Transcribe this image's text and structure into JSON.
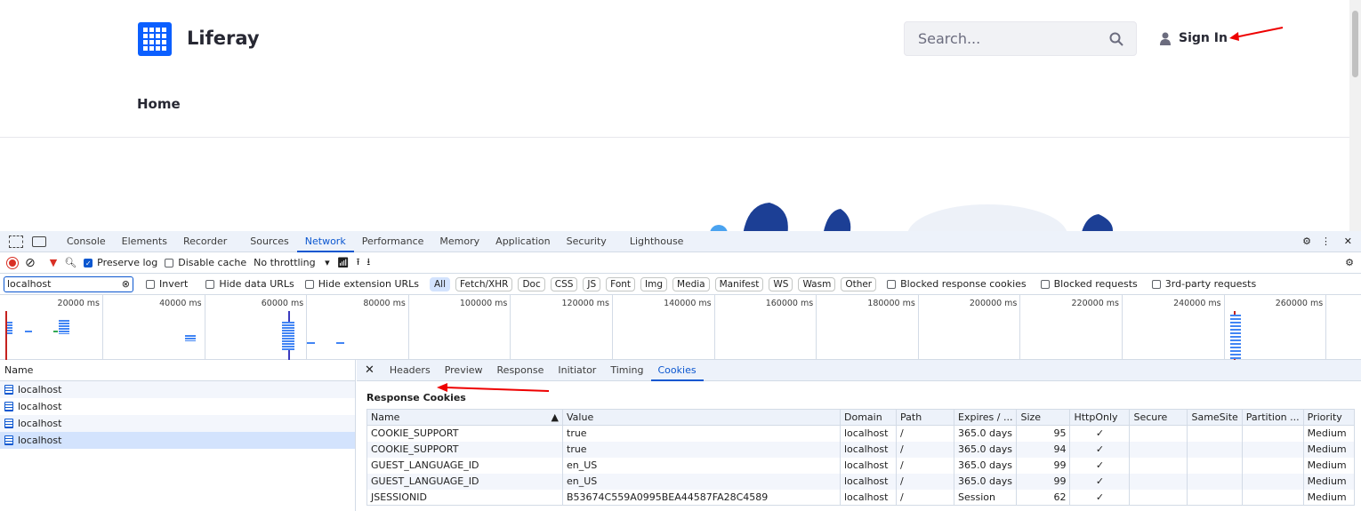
{
  "site": {
    "brand": "Liferay",
    "search_placeholder": "Search...",
    "sign_in": "Sign In",
    "nav_home": "Home"
  },
  "devtools": {
    "tabs": [
      "Console",
      "Elements",
      "Recorder",
      "Sources",
      "Network",
      "Performance",
      "Memory",
      "Application",
      "Security",
      "Lighthouse"
    ],
    "active_tab": "Network",
    "toolbar": {
      "preserve_log": "Preserve log",
      "disable_cache": "Disable cache",
      "throttling": "No throttling"
    },
    "filter": {
      "value": "localhost",
      "invert": "Invert",
      "hide_data": "Hide data URLs",
      "hide_ext": "Hide extension URLs",
      "types": [
        "All",
        "Fetch/XHR",
        "Doc",
        "CSS",
        "JS",
        "Font",
        "Img",
        "Media",
        "Manifest",
        "WS",
        "Wasm",
        "Other"
      ],
      "blocked_cookies": "Blocked response cookies",
      "blocked_requests": "Blocked requests",
      "third_party": "3rd-party requests"
    },
    "timeline_ticks": [
      "20000 ms",
      "40000 ms",
      "60000 ms",
      "80000 ms",
      "100000 ms",
      "120000 ms",
      "140000 ms",
      "160000 ms",
      "180000 ms",
      "200000 ms",
      "220000 ms",
      "240000 ms",
      "260000 ms"
    ],
    "requests_header": "Name",
    "requests": [
      "localhost",
      "localhost",
      "localhost",
      "localhost"
    ],
    "detail_tabs": [
      "Headers",
      "Preview",
      "Response",
      "Initiator",
      "Timing",
      "Cookies"
    ],
    "active_detail_tab": "Cookies",
    "section_title": "Response Cookies",
    "columns": [
      "Name",
      "Value",
      "Domain",
      "Path",
      "Expires / ...",
      "Size",
      "HttpOnly",
      "Secure",
      "SameSite",
      "Partition ...",
      "Priority"
    ],
    "cookies": [
      [
        "COOKIE_SUPPORT",
        "true",
        "localhost",
        "/",
        "365.0 days",
        "95",
        "✓",
        "",
        "",
        "",
        "Medium"
      ],
      [
        "COOKIE_SUPPORT",
        "true",
        "localhost",
        "/",
        "365.0 days",
        "94",
        "✓",
        "",
        "",
        "",
        "Medium"
      ],
      [
        "GUEST_LANGUAGE_ID",
        "en_US",
        "localhost",
        "/",
        "365.0 days",
        "99",
        "✓",
        "",
        "",
        "",
        "Medium"
      ],
      [
        "GUEST_LANGUAGE_ID",
        "en_US",
        "localhost",
        "/",
        "365.0 days",
        "99",
        "✓",
        "",
        "",
        "",
        "Medium"
      ],
      [
        "JSESSIONID",
        "B53674C559A0995BEA44587FA28C4589",
        "localhost",
        "/",
        "Session",
        "62",
        "✓",
        "",
        "",
        "",
        "Medium"
      ]
    ]
  }
}
